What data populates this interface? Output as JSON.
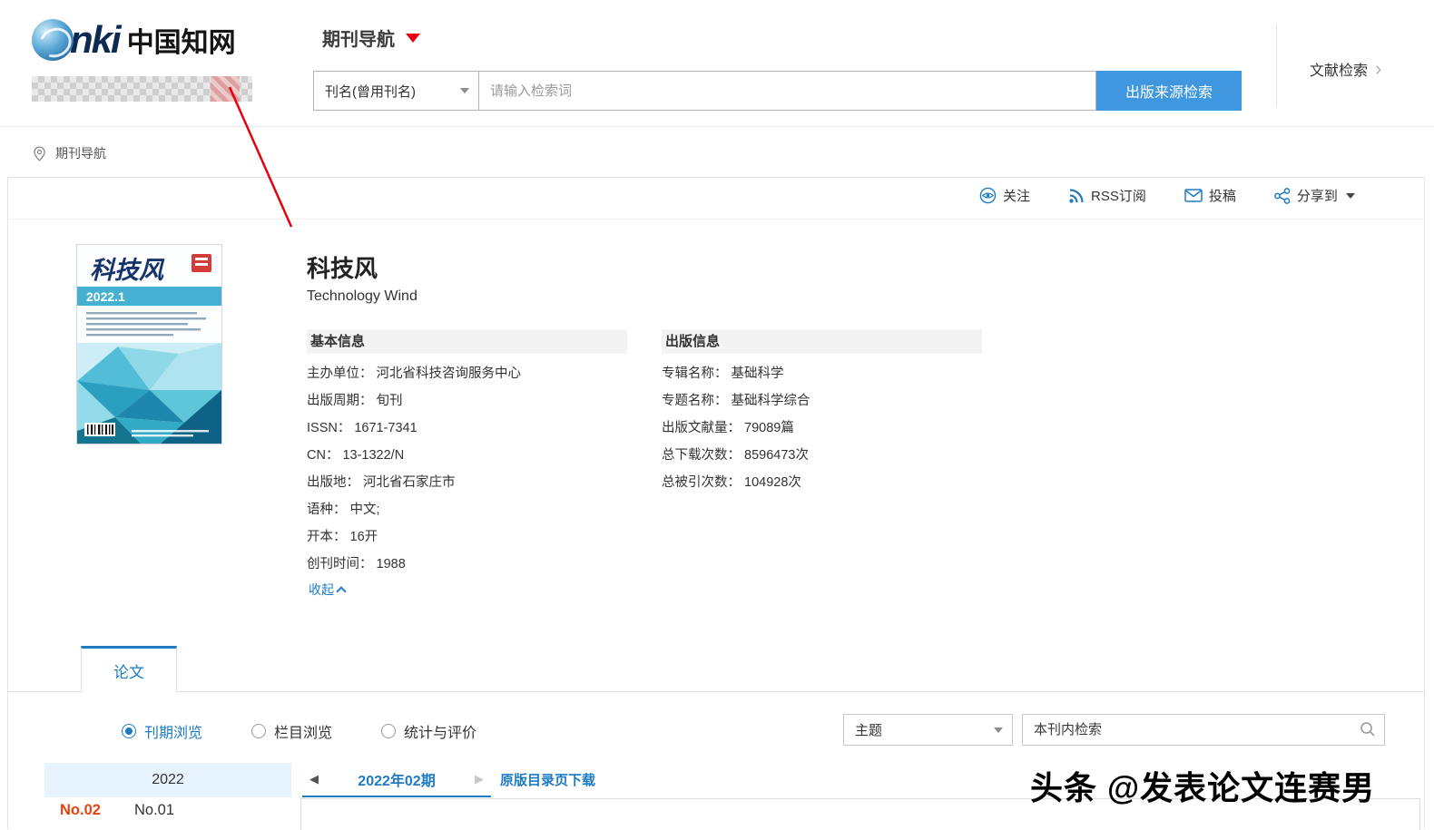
{
  "colors": {
    "accent_blue": "#1e7bc4",
    "button_blue": "#3e97df",
    "annotation_red": "#e60012",
    "current_issue_red": "#e8430f",
    "year_highlight_bg": "#e6f3fc"
  },
  "header": {
    "logo_cnki": "nki",
    "logo_chinese": "中国知网",
    "nav_title": "期刊导航",
    "search": {
      "field_dropdown": "刊名(曾用刊名)",
      "placeholder": "请输入检索词",
      "button": "出版来源检索"
    },
    "doc_search": "文献检索",
    "doc_search_chevron": "›"
  },
  "breadcrumb": "期刊导航",
  "toolbar": {
    "follow": "关注",
    "rss": "RSS订阅",
    "contribute": "投稿",
    "share": "分享到"
  },
  "journal": {
    "title": "科技风",
    "title_en": "Technology Wind",
    "cover_title": "科技风",
    "cover_issue": "2022.1",
    "basic_info": {
      "heading": "基本信息",
      "items": [
        {
          "label": "主办单位：",
          "value": "河北省科技咨询服务中心"
        },
        {
          "label": "出版周期：",
          "value": "旬刊"
        },
        {
          "label": "ISSN：",
          "value": "1671-7341"
        },
        {
          "label": "CN：",
          "value": "13-1322/N"
        },
        {
          "label": "出版地：",
          "value": "河北省石家庄市"
        },
        {
          "label": "语种：",
          "value": "中文;"
        },
        {
          "label": "开本：",
          "value": "16开"
        },
        {
          "label": "创刊时间：",
          "value": "1988"
        }
      ],
      "collapse": "收起"
    },
    "pub_info": {
      "heading": "出版信息",
      "items": [
        {
          "label": "专辑名称：",
          "value": "基础科学"
        },
        {
          "label": "专题名称：",
          "value": "基础科学综合"
        },
        {
          "label": "出版文献量：",
          "value": "79089篇"
        },
        {
          "label": "总下载次数：",
          "value": "8596473次"
        },
        {
          "label": "总被引次数：",
          "value": "104928次"
        }
      ]
    }
  },
  "tabs": {
    "papers": "论文"
  },
  "browse": {
    "options": [
      {
        "label": "刊期浏览",
        "selected": true
      },
      {
        "label": "栏目浏览",
        "selected": false
      },
      {
        "label": "统计与评价",
        "selected": false
      }
    ],
    "topic_dropdown": "主题",
    "inner_search_placeholder": "本刊内检索"
  },
  "issues": {
    "year": "2022",
    "current": "2022年02期",
    "prev_icon": "◀",
    "next_icon": "▶",
    "download": "原版目录页下载",
    "list": [
      "No.02",
      "No.01"
    ]
  },
  "watermark": "头条 @发表论文连赛男"
}
